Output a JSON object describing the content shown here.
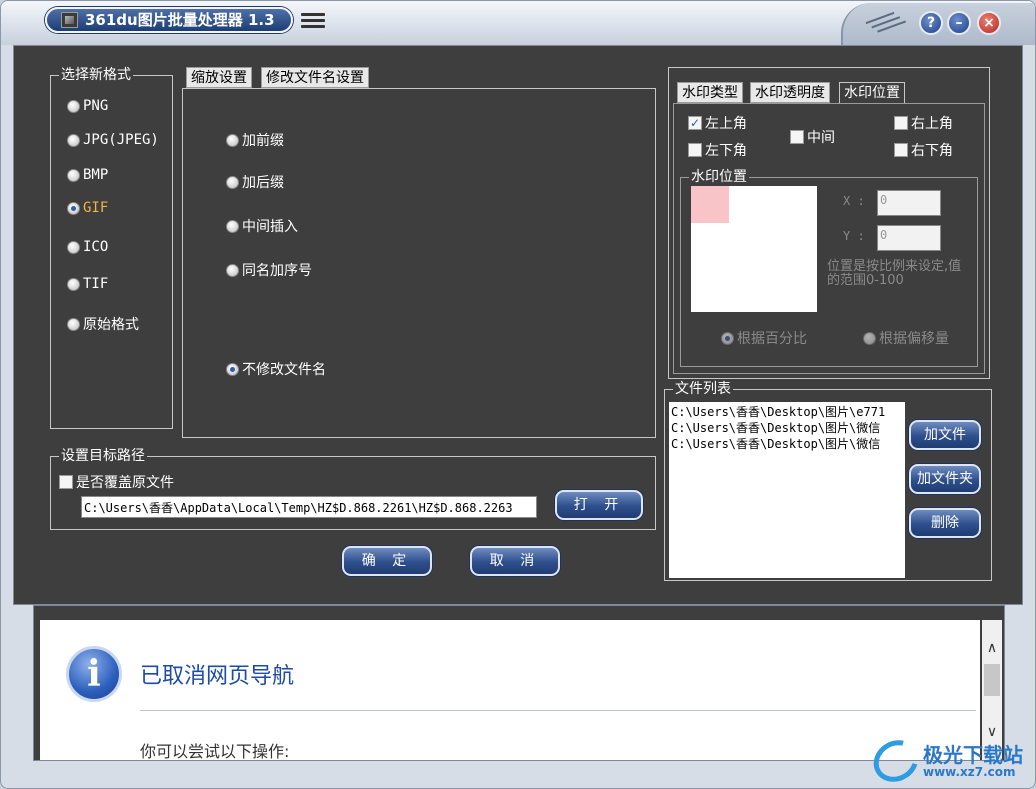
{
  "window": {
    "title": "361du图片批量处理器 1.3"
  },
  "format_group": {
    "title": "选择新格式",
    "options": [
      "PNG",
      "JPG(JPEG)",
      "BMP",
      "GIF",
      "ICO",
      "TIF",
      "原始格式"
    ],
    "selected": "GIF"
  },
  "rename_tabs": [
    "缩放设置",
    "修改文件名设置"
  ],
  "rename_options": {
    "prefix": "加前缀",
    "suffix": "加后缀",
    "insert": "中间插入",
    "sequence": "同名加序号",
    "none": "不修改文件名"
  },
  "target": {
    "title": "设置目标路径",
    "overwrite_label": "是否覆盖原文件",
    "path_value": "C:\\Users\\香香\\AppData\\Local\\Temp\\HZ$D.868.2261\\HZ$D.868.2263",
    "open_label": "打 开"
  },
  "actions": {
    "confirm": "确 定",
    "cancel": "取 消"
  },
  "watermark_panel": {
    "tabs": [
      "水印类型",
      "水印透明度",
      "水印位置"
    ],
    "top_left": "左上角",
    "top_right": "右上角",
    "center": "中间",
    "bottom_left": "左下角",
    "bottom_right": "右下角",
    "position_title": "水印位置",
    "x_label": "X :",
    "x_value": "0",
    "y_label": "Y :",
    "y_value": "0",
    "note": "位置是按比例来设定,值的范围0-100",
    "by_percent": "根据百分比",
    "by_offset": "根据偏移量"
  },
  "file_list": {
    "title": "文件列表",
    "items": [
      "C:\\Users\\香香\\Desktop\\图片\\e771",
      "C:\\Users\\香香\\Desktop\\图片\\微信",
      "C:\\Users\\香香\\Desktop\\图片\\微信"
    ],
    "add_file": "加文件",
    "add_folder": "加文件夹",
    "delete": "删除"
  },
  "webview": {
    "title": "已取消网页导航",
    "hint": "你可以尝试以下操作:"
  },
  "site_watermark": {
    "name": "极光下载站",
    "url": "www.xz7.com"
  }
}
